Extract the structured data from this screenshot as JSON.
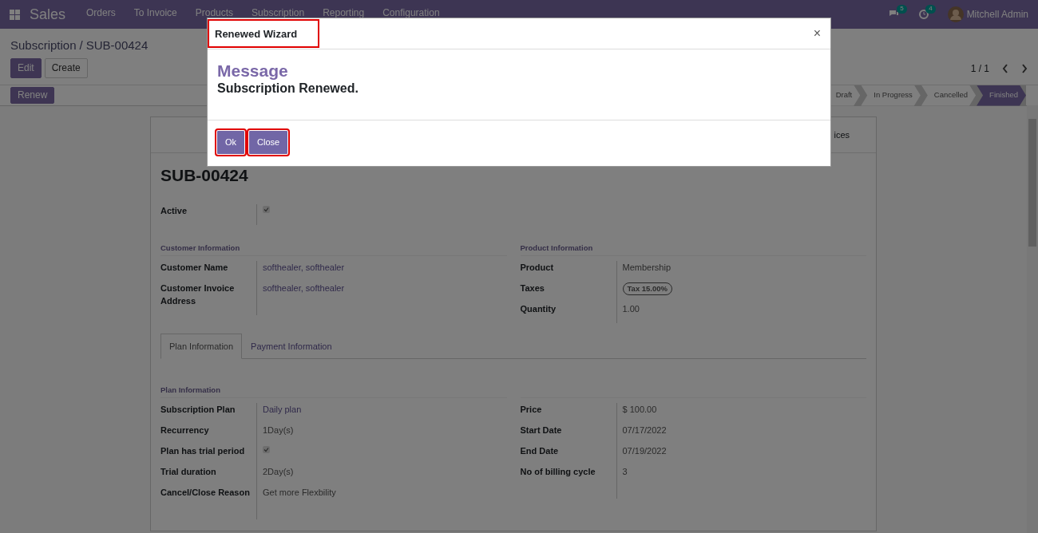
{
  "navbar": {
    "app": "Sales",
    "menu": [
      "Orders",
      "To Invoice",
      "Products",
      "Subscription",
      "Reporting",
      "Configuration"
    ],
    "messages_count": "5",
    "activities_count": "4",
    "user": "Mitchell Admin"
  },
  "control_panel": {
    "breadcrumb": [
      "Subscription",
      "SUB-00424"
    ],
    "separator": "/",
    "buttons": [
      "Edit",
      "Create"
    ],
    "pager": "1 / 1",
    "actions": [
      "Renew"
    ],
    "stages": [
      {
        "label": "Draft",
        "selected": false
      },
      {
        "label": "In Progress",
        "selected": false
      },
      {
        "label": "Cancelled",
        "selected": false
      },
      {
        "label": "Finished",
        "selected": true
      }
    ]
  },
  "form": {
    "smart_button_text": "ices",
    "title": "SUB-00424",
    "top_fields": [
      {
        "label": "Active",
        "kind": "checkbox",
        "checked": true
      }
    ],
    "groups": [
      {
        "title": "Customer Information",
        "fields": [
          {
            "label": "Customer Name",
            "kind": "link",
            "value": "softhealer, softhealer"
          },
          {
            "label": "Customer Invoice Address",
            "kind": "link",
            "value": "softhealer, softhealer"
          }
        ]
      },
      {
        "title": "Product Information",
        "fields": [
          {
            "label": "Product",
            "kind": "text",
            "value": "Membership"
          },
          {
            "label": "Taxes",
            "kind": "tag",
            "value": "Tax 15.00%"
          },
          {
            "label": "Quantity",
            "kind": "text",
            "value": "1.00"
          }
        ]
      }
    ],
    "tabs": [
      {
        "label": "Plan Information",
        "selected": true
      },
      {
        "label": "Payment Information",
        "selected": false
      }
    ],
    "tab_groups": [
      {
        "title": "Plan Information",
        "fields": [
          {
            "label": "Subscription Plan",
            "kind": "link",
            "value": "Daily plan"
          },
          {
            "label": "Recurrency",
            "kind": "text",
            "value": "1Day(s)"
          },
          {
            "label": "Plan has trial period",
            "kind": "checkbox",
            "checked": true
          },
          {
            "label": "Trial duration",
            "kind": "text",
            "value": "2Day(s)"
          },
          {
            "label": "Cancel/Close Reason",
            "kind": "text",
            "value": "Get more Flexbility"
          }
        ]
      },
      {
        "fields": [
          {
            "label": "Price",
            "kind": "text",
            "value": "$ 100.00"
          },
          {
            "label": "Start Date",
            "kind": "text",
            "value": "07/17/2022"
          },
          {
            "label": "End Date",
            "kind": "text",
            "value": "07/19/2022"
          },
          {
            "label": "No of billing cycle",
            "kind": "text",
            "value": "3"
          }
        ]
      }
    ]
  },
  "dialog": {
    "title": "Renewed Wizard",
    "title_highlighted": true,
    "close_symbol": "×",
    "heading": "Message",
    "message": "Subscription Renewed.",
    "buttons": [
      {
        "label": "Ok",
        "highlighted": true
      },
      {
        "label": "Close",
        "highlighted": true
      }
    ]
  }
}
